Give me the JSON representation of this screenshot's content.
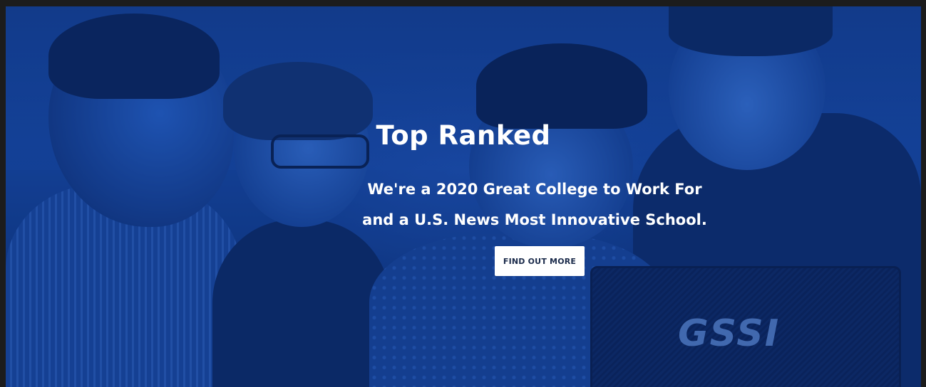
{
  "hero": {
    "title": "Top Ranked",
    "subtitle_line1": "We're a 2020 Great College to Work For",
    "subtitle_line2": "and a U.S. News Most Innovative School.",
    "cta_label": "FIND OUT MORE",
    "case_logo": "GSSI",
    "overlay_color": "#1f5bc2"
  }
}
